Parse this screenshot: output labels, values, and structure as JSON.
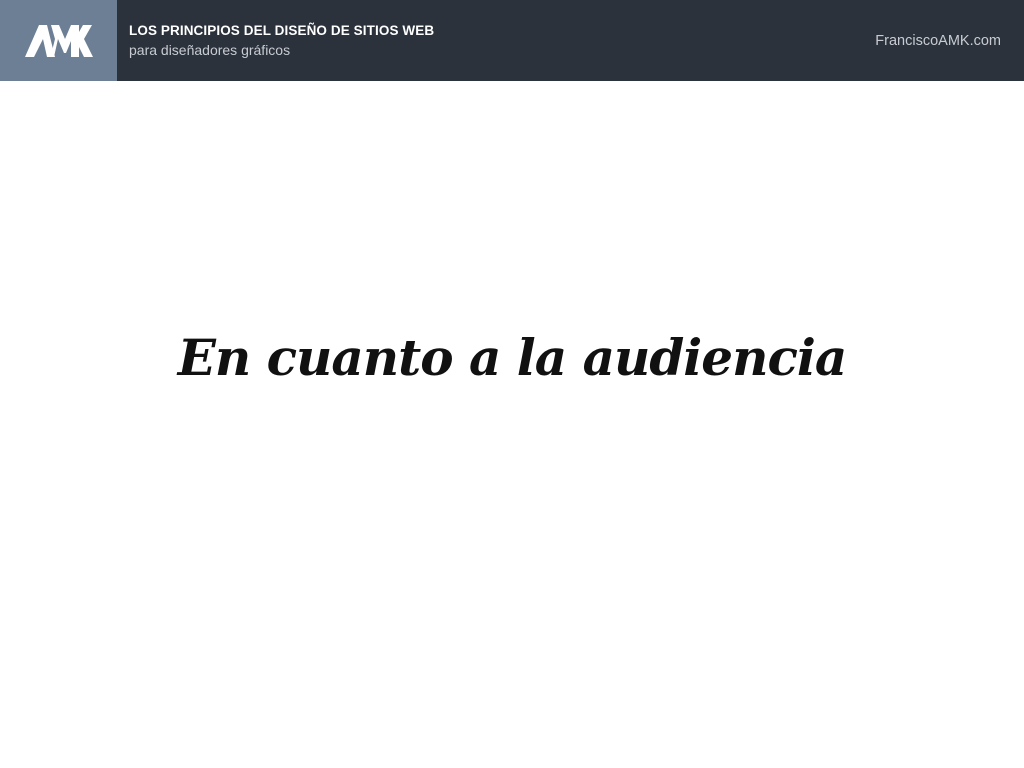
{
  "header": {
    "logo": {
      "icon": "amk-logo-icon",
      "text": "AMK",
      "background": "#6d7f95"
    },
    "course_title": "LOS PRINCIPIOS DEL DISEÑO DE SITIOS WEB",
    "course_subtitle": "para diseñadores gráficos",
    "site_link": "FranciscoAMK.com",
    "background": "#2b323c"
  },
  "slide": {
    "heading": "En cuanto a la audiencia",
    "background": "#ffffff"
  }
}
